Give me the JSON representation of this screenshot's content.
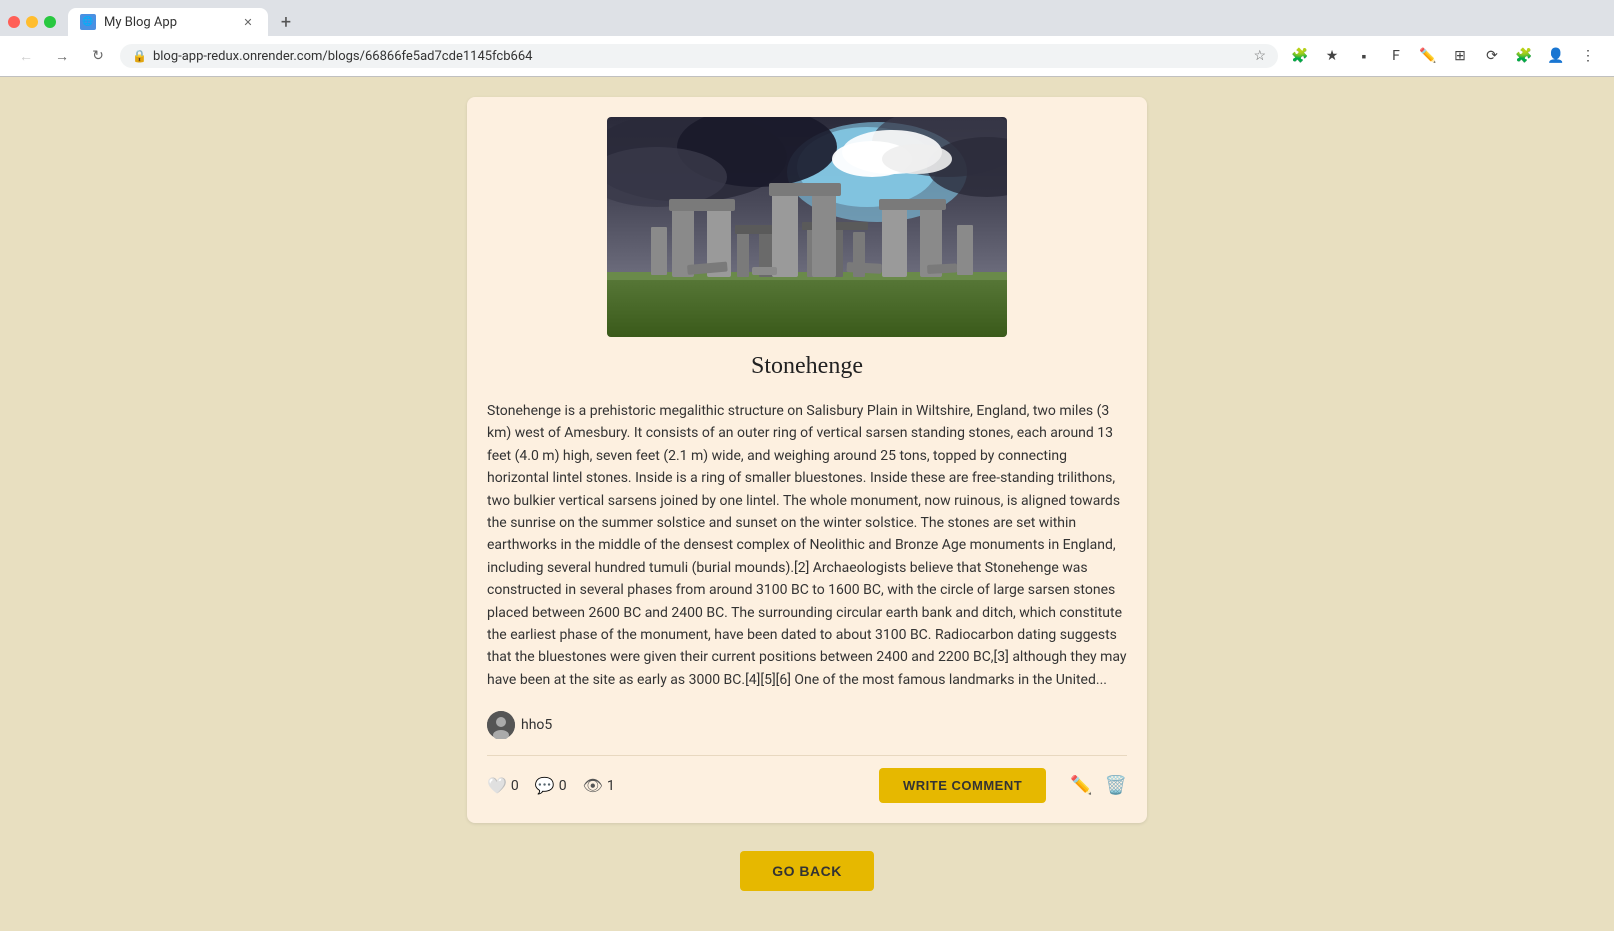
{
  "browser": {
    "tab_title": "My Blog App",
    "url": "blog-app-redux.onrender.com/blogs/66866fe5ad7cde1145fcb664",
    "back_button": "←",
    "forward_button": "→",
    "reload_button": "↻"
  },
  "blog": {
    "title": "Stonehenge",
    "body": "Stonehenge is a prehistoric megalithic structure on Salisbury Plain in Wiltshire, England, two miles (3 km) west of Amesbury. It consists of an outer ring of vertical sarsen standing stones, each around 13 feet (4.0 m) high, seven feet (2.1 m) wide, and weighing around 25 tons, topped by connecting horizontal lintel stones. Inside is a ring of smaller bluestones. Inside these are free-standing trilithons, two bulkier vertical sarsens joined by one lintel. The whole monument, now ruinous, is aligned towards the sunrise on the summer solstice and sunset on the winter solstice. The stones are set within earthworks in the middle of the densest complex of Neolithic and Bronze Age monuments in England, including several hundred tumuli (burial mounds).[2] Archaeologists believe that Stonehenge was constructed in several phases from around 3100 BC to 1600 BC, with the circle of large sarsen stones placed between 2600 BC and 2400 BC. The surrounding circular earth bank and ditch, which constitute the earliest phase of the monument, have been dated to about 3100 BC. Radiocarbon dating suggests that the bluestones were given their current positions between 2400 and 2200 BC,[3] although they may have been at the site as early as 3000 BC.[4][5][6] One of the most famous landmarks in the United...",
    "author": "hho5",
    "likes": "0",
    "comments": "0",
    "views": "1",
    "write_comment_label": "WRITE COMMENT",
    "go_back_label": "GO BACK"
  }
}
